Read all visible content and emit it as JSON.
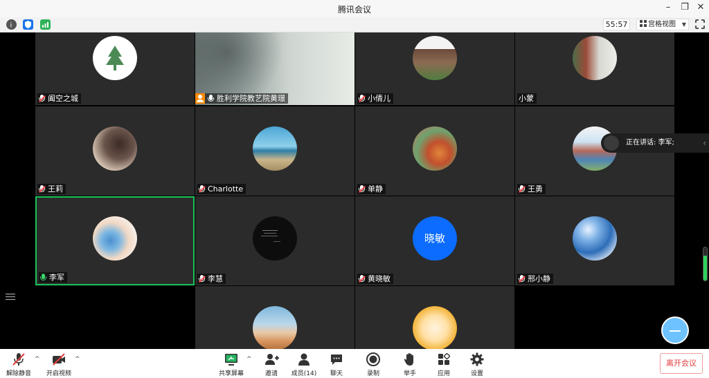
{
  "window": {
    "title": "腾讯会议"
  },
  "statusbar": {
    "timer": "55:57",
    "view_label": "宫格视图"
  },
  "speaker": {
    "text": "正在讲话: 李军;"
  },
  "participants": [
    {
      "name": "阖空之城",
      "mic": "muted"
    },
    {
      "name": "胜利学院教艺院黄璟",
      "mic": "on",
      "host": true
    },
    {
      "name": "小倩儿",
      "mic": "muted"
    },
    {
      "name": "小蒙",
      "mic": "none"
    },
    {
      "name": "王莉",
      "mic": "muted"
    },
    {
      "name": "Charlotte",
      "mic": "muted"
    },
    {
      "name": "单静",
      "mic": "muted"
    },
    {
      "name": "王勇",
      "mic": "muted"
    },
    {
      "name": "李军",
      "mic": "speaking",
      "active": true
    },
    {
      "name": "李慧",
      "mic": "muted"
    },
    {
      "name": "黄晓敏",
      "mic": "muted",
      "avatar_text": "晓敏"
    },
    {
      "name": "邢小静",
      "mic": "muted"
    },
    {
      "name": "",
      "mic": "none"
    },
    {
      "name": "",
      "mic": "none"
    }
  ],
  "volume_level": 0.75,
  "toolbar": {
    "unmute": "解除静音",
    "start_video": "开启视频",
    "share_screen": "共享屏幕",
    "invite": "邀请",
    "members": "成员(14)",
    "chat": "聊天",
    "record": "录制",
    "raise_hand": "举手",
    "apps": "应用",
    "settings": "设置",
    "leave": "离开会议"
  },
  "colors": {
    "active_border": "#19c45b",
    "accent_blue": "#0b6cff",
    "leave_red": "#e23b3b"
  }
}
